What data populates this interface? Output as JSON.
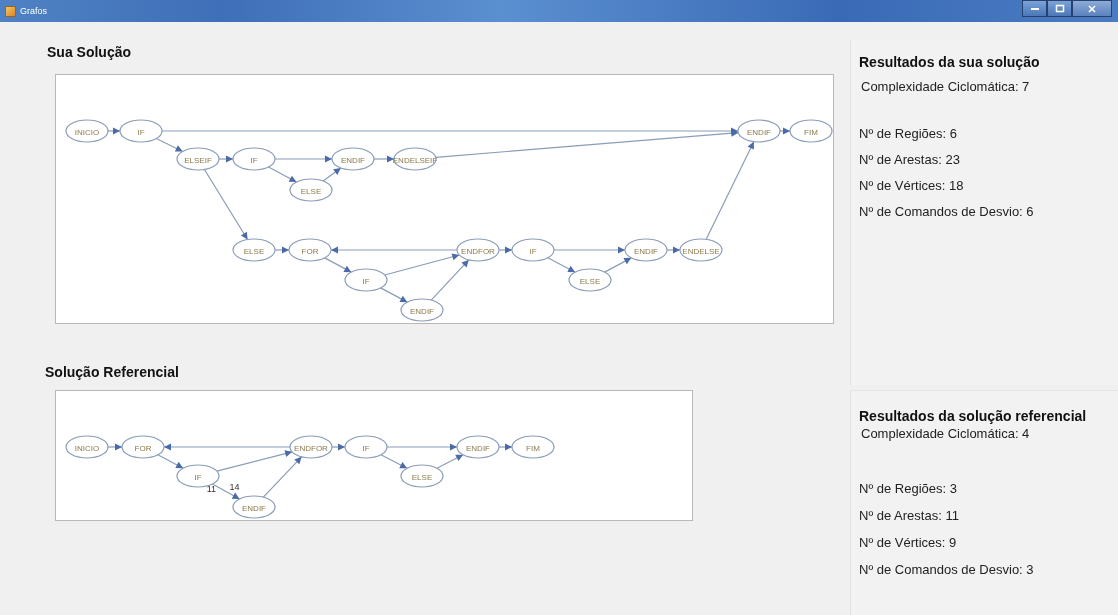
{
  "window": {
    "title": "Grafos"
  },
  "solutions": [
    {
      "heading": "Sua Solução",
      "graph": {
        "nodes": [
          "INICIO",
          "IF",
          "ELSEIF",
          "IF",
          "ENDIF",
          "ENDELSEIF",
          "ELSE",
          "ENDIF",
          "FIM",
          "ELSE",
          "FOR",
          "IF",
          "ENDIF",
          "ENDFOR",
          "IF",
          "ELSE",
          "ENDIF",
          "ENDELSE"
        ]
      }
    },
    {
      "heading": "Solução Referencial",
      "graph": {
        "nodes": [
          "INICIO",
          "FOR",
          "IF",
          "ENDIF",
          "ENDFOR",
          "IF",
          "ELSE",
          "ENDIF",
          "FIM"
        ],
        "edge_labels": [
          "11",
          "14"
        ]
      }
    }
  ],
  "results": [
    {
      "heading": "Resultados da sua solução",
      "complexity": "Complexidade Ciclomática: 7",
      "stats": [
        "Nº de Regiões: 6",
        "Nº de Arestas: 23",
        "Nº de Vértices: 18",
        "Nº de Comandos de Desvio: 6"
      ]
    },
    {
      "heading": "Resultados da solução referencial",
      "complexity": "Complexidade Ciclomática: 4",
      "stats": [
        "Nº de Regiões: 3",
        "Nº de Arestas: 11",
        "Nº de Vértices: 9",
        "Nº de Comandos de Desvio: 3"
      ]
    }
  ]
}
